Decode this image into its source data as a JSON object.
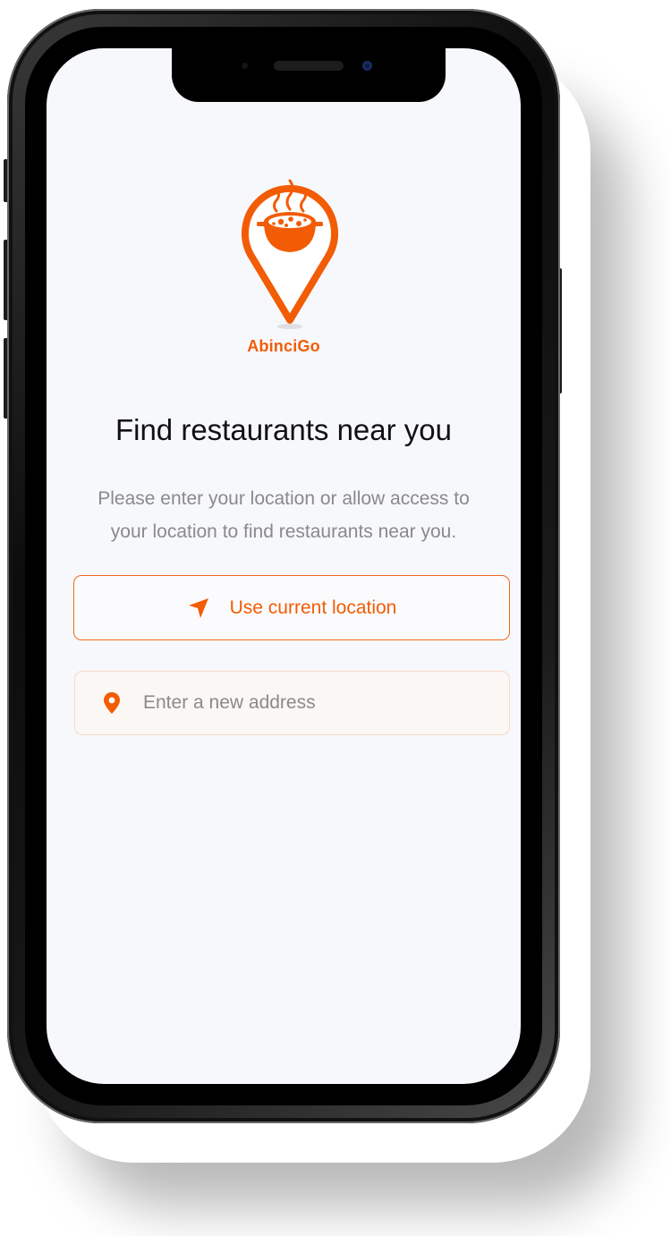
{
  "app": {
    "brand": "AbinciGo",
    "accent_color": "#f25c05"
  },
  "main": {
    "title": "Find restaurants near you",
    "subtitle": "Please enter your location or allow access to your location to find restaurants near you.",
    "use_location_button": {
      "label": "Use current location",
      "icon": "navigation-arrow-icon"
    },
    "address_input": {
      "placeholder": "Enter a new address",
      "value": "",
      "icon": "location-pin-icon"
    }
  },
  "logo": {
    "icon": "pin-with-cooking-pot-logo"
  }
}
